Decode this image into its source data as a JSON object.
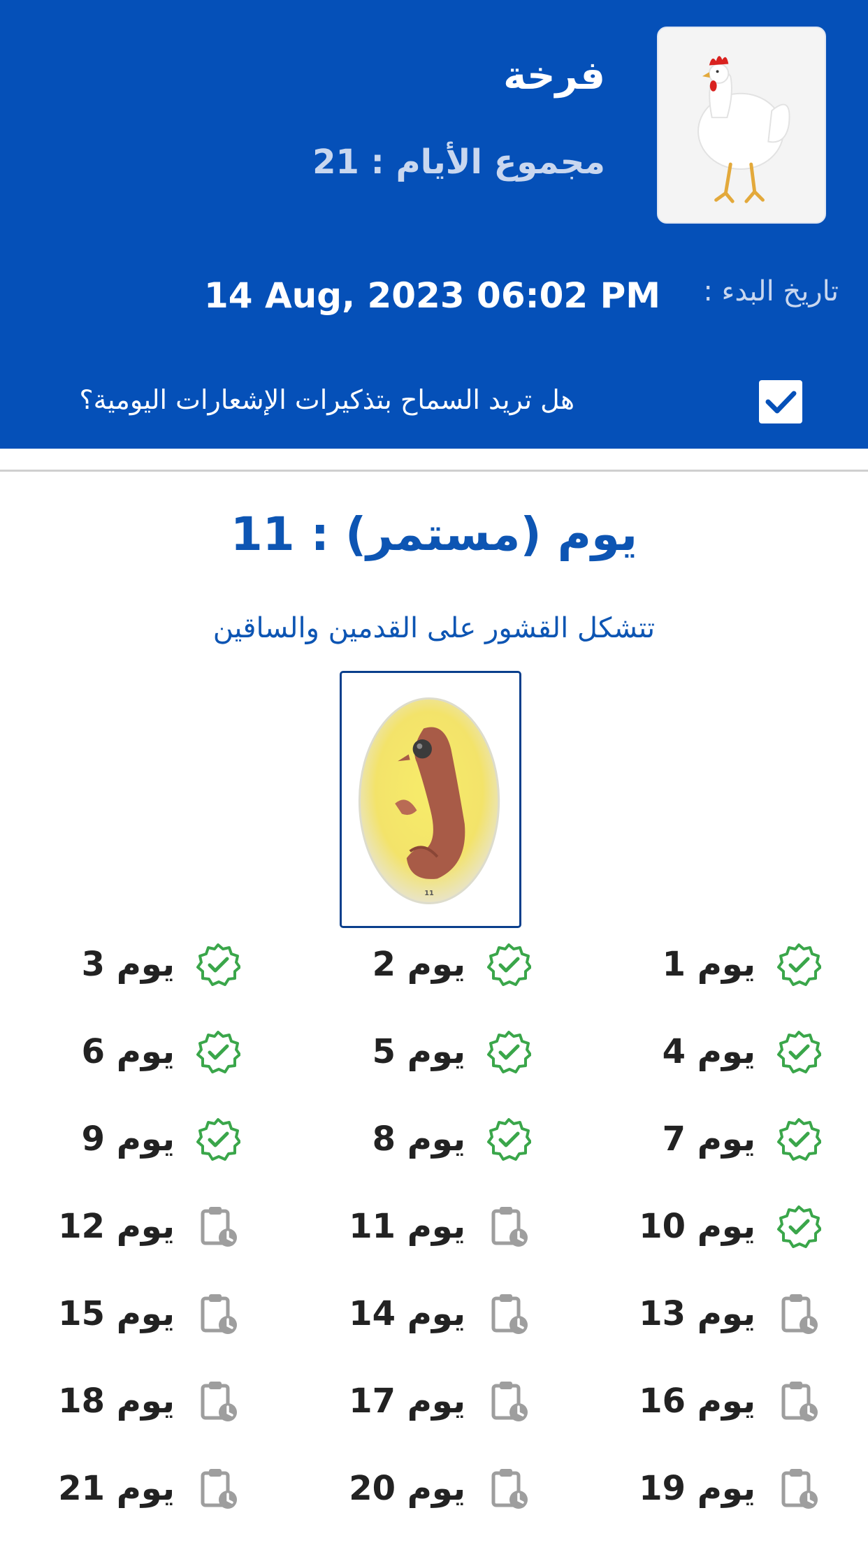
{
  "header": {
    "bird_name": "فرخة",
    "total_days_text": "مجموع الأيام : 21",
    "start_label": "تاريخ البدء :",
    "start_value": "14 Aug, 2023 06:02 PM",
    "notifications_question": "هل تريد السماح بتذكيرات الإشعارات اليومية؟",
    "notifications_enabled": true
  },
  "current": {
    "title": "يوم (مستمر) : 11",
    "description": "تتشكل القشور على القدمين والساقين",
    "image_caption": "11"
  },
  "colors": {
    "header_bg": "#0550b8",
    "accent": "#0d55b3",
    "done": "#3aa64a",
    "pending": "#9e9e9e"
  },
  "days": [
    {
      "label": "يوم 1",
      "status": "done",
      "icon": "check-badge-icon"
    },
    {
      "label": "يوم 2",
      "status": "done",
      "icon": "check-badge-icon"
    },
    {
      "label": "يوم 3",
      "status": "done",
      "icon": "check-badge-icon"
    },
    {
      "label": "يوم 4",
      "status": "done",
      "icon": "check-badge-icon"
    },
    {
      "label": "يوم 5",
      "status": "done",
      "icon": "check-badge-icon"
    },
    {
      "label": "يوم 6",
      "status": "done",
      "icon": "check-badge-icon"
    },
    {
      "label": "يوم 7",
      "status": "done",
      "icon": "check-badge-icon"
    },
    {
      "label": "يوم 8",
      "status": "done",
      "icon": "check-badge-icon"
    },
    {
      "label": "يوم 9",
      "status": "done",
      "icon": "check-badge-icon"
    },
    {
      "label": "يوم 10",
      "status": "done",
      "icon": "check-badge-icon"
    },
    {
      "label": "يوم 11",
      "status": "pending",
      "icon": "clipboard-clock-icon"
    },
    {
      "label": "يوم 12",
      "status": "pending",
      "icon": "clipboard-clock-icon"
    },
    {
      "label": "يوم 13",
      "status": "pending",
      "icon": "clipboard-clock-icon"
    },
    {
      "label": "يوم 14",
      "status": "pending",
      "icon": "clipboard-clock-icon"
    },
    {
      "label": "يوم 15",
      "status": "pending",
      "icon": "clipboard-clock-icon"
    },
    {
      "label": "يوم 16",
      "status": "pending",
      "icon": "clipboard-clock-icon"
    },
    {
      "label": "يوم 17",
      "status": "pending",
      "icon": "clipboard-clock-icon"
    },
    {
      "label": "يوم 18",
      "status": "pending",
      "icon": "clipboard-clock-icon"
    },
    {
      "label": "يوم 19",
      "status": "pending",
      "icon": "clipboard-clock-icon"
    },
    {
      "label": "يوم 20",
      "status": "pending",
      "icon": "clipboard-clock-icon"
    },
    {
      "label": "يوم 21",
      "status": "pending",
      "icon": "clipboard-clock-icon"
    }
  ]
}
